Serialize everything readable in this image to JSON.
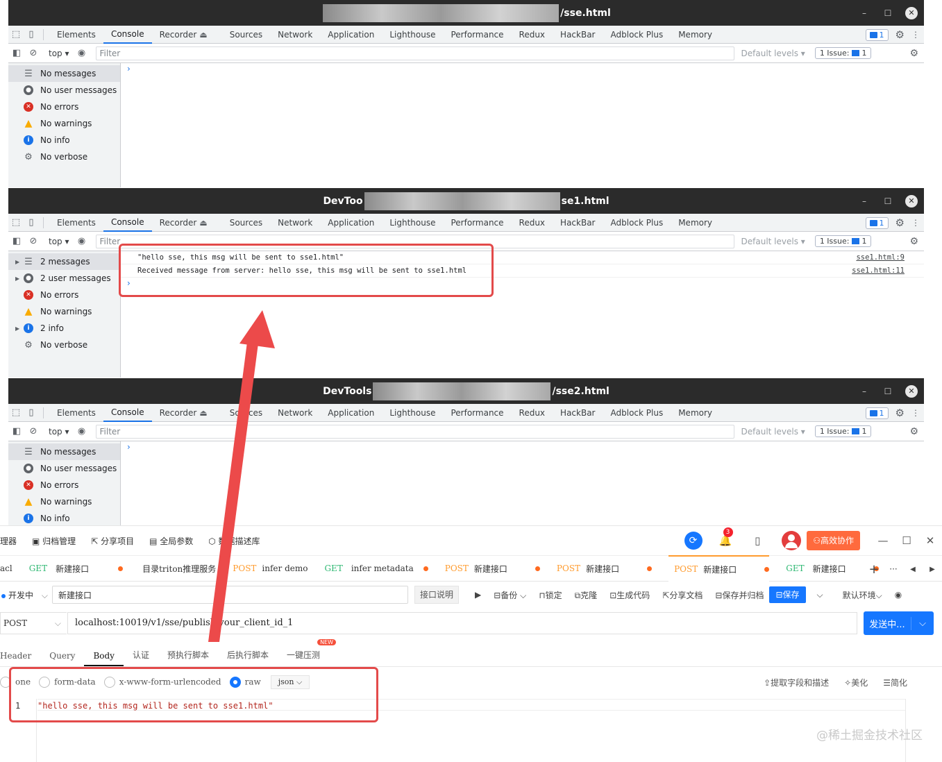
{
  "devtools": {
    "tabs": [
      "Elements",
      "Console",
      "Recorder",
      "Sources",
      "Network",
      "Application",
      "Lighthouse",
      "Performance",
      "Redux",
      "HackBar",
      "Adblock Plus",
      "Memory"
    ],
    "recorder_suffix": "⏏",
    "issue_count": "1",
    "toolbar": {
      "context": "top",
      "filter_placeholder": "Filter",
      "levels": "Default levels",
      "issues_label": "1 Issue:",
      "issues_count": "1"
    },
    "windows": [
      {
        "title_prefix": "",
        "title_suffix": "/sse.html",
        "sidebar": [
          {
            "icon": "list",
            "label": "No messages",
            "selected": true,
            "expand": false
          },
          {
            "icon": "user",
            "label": "No user messages",
            "selected": false,
            "expand": false
          },
          {
            "icon": "err",
            "label": "No errors",
            "selected": false,
            "expand": false
          },
          {
            "icon": "warn",
            "label": "No warnings",
            "selected": false,
            "expand": false
          },
          {
            "icon": "info",
            "label": "No info",
            "selected": false,
            "expand": false
          },
          {
            "icon": "verb",
            "label": "No verbose",
            "selected": false,
            "expand": false
          }
        ],
        "logs": []
      },
      {
        "title_prefix": "DevToo",
        "title_suffix": "se1.html",
        "sidebar": [
          {
            "icon": "list",
            "label": "2 messages",
            "selected": true,
            "expand": true
          },
          {
            "icon": "user",
            "label": "2 user messages",
            "selected": false,
            "expand": true
          },
          {
            "icon": "err",
            "label": "No errors",
            "selected": false,
            "expand": false
          },
          {
            "icon": "warn",
            "label": "No warnings",
            "selected": false,
            "expand": false
          },
          {
            "icon": "info",
            "label": "2 info",
            "selected": false,
            "expand": true
          },
          {
            "icon": "verb",
            "label": "No verbose",
            "selected": false,
            "expand": false
          }
        ],
        "logs": [
          {
            "text": "\"hello sse, this msg will be sent to sse1.html\"",
            "source": "sse1.html:9"
          },
          {
            "text": "Received message from server: hello sse, this msg will be sent to sse1.html",
            "source": "sse1.html:11"
          }
        ]
      },
      {
        "title_prefix": "DevTools",
        "title_suffix": "/sse2.html",
        "sidebar": [
          {
            "icon": "list",
            "label": "No messages",
            "selected": true,
            "expand": false
          },
          {
            "icon": "user",
            "label": "No user messages",
            "selected": false,
            "expand": false
          },
          {
            "icon": "err",
            "label": "No errors",
            "selected": false,
            "expand": false
          },
          {
            "icon": "warn",
            "label": "No warnings",
            "selected": false,
            "expand": false
          },
          {
            "icon": "info",
            "label": "No info",
            "selected": false,
            "expand": false
          }
        ],
        "logs": []
      }
    ],
    "win_controls": {
      "minimize": "–",
      "maximize": "☐",
      "close": "✕"
    }
  },
  "api_tool": {
    "menu": [
      "理器",
      "归档管理",
      "分享项目",
      "全局参数",
      "数据描述库"
    ],
    "menu_icons": [
      "",
      "archive-icon",
      "share-icon",
      "globe-icon",
      "cube-icon"
    ],
    "notification_count": "3",
    "collab_label": "高效协作",
    "request_tabs": [
      {
        "method": "",
        "name": "acl",
        "dot": false
      },
      {
        "method": "GET",
        "name": "新建接口",
        "dot": true
      },
      {
        "method": "",
        "name": "目录triton推理服务",
        "dot": false
      },
      {
        "method": "POST",
        "name": "infer demo",
        "dot": false
      },
      {
        "method": "GET",
        "name": "infer metadata",
        "dot": true
      },
      {
        "method": "POST",
        "name": "新建接口",
        "dot": true
      },
      {
        "method": "POST",
        "name": "新建接口",
        "dot": true
      },
      {
        "method": "POST",
        "name": "新建接口",
        "dot": true,
        "active": true
      },
      {
        "method": "GET",
        "name": "新建接口",
        "dot": true
      }
    ],
    "tab_controls": {
      "add": "+",
      "more": "···",
      "prev": "◀",
      "next": "▶"
    },
    "status": "开发中",
    "interface_name": "新建接口",
    "doc_button": "接口说明",
    "toolbar": [
      "备份",
      "锁定",
      "克隆",
      "生成代码",
      "分享文档",
      "保存并归档"
    ],
    "save_label": "保存",
    "env_label": "默认环境",
    "method": "POST",
    "url": "localhost:10019/v1/sse/publish/your_client_id_1",
    "send_label": "发送中...",
    "body_tabs": [
      "Header",
      "Query",
      "Body",
      "认证",
      "预执行脚本",
      "后执行脚本",
      "一键压测"
    ],
    "active_body_tab": "Body",
    "new_badge": "NEW",
    "body_types": [
      "one",
      "form-data",
      "x-www-form-urlencoded",
      "raw"
    ],
    "body_format": "json",
    "body_actions": [
      "提取字段和描述",
      "美化",
      "简化"
    ],
    "editor": {
      "line": "1",
      "code": "\"hello sse, this msg will be sent to sse1.html\""
    },
    "watermark": "@稀土掘金技术社区"
  }
}
